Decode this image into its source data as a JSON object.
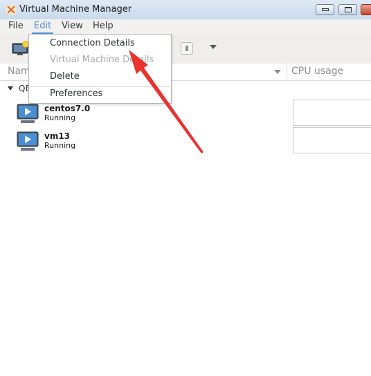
{
  "window": {
    "title": "Virtual Machine Manager",
    "icon": "virt-manager-icon"
  },
  "menubar": {
    "items": [
      {
        "label": "File"
      },
      {
        "label": "Edit",
        "active": true
      },
      {
        "label": "View"
      },
      {
        "label": "Help"
      }
    ]
  },
  "edit_menu": {
    "items": [
      {
        "label": "Connection Details",
        "enabled": true
      },
      {
        "label": "Virtual Machine Details",
        "enabled": false
      },
      {
        "label": "Delete",
        "enabled": true
      },
      {
        "label": "Preferences",
        "enabled": true
      }
    ]
  },
  "columns": {
    "name": "Nam",
    "cpu": "CPU usage"
  },
  "connection": {
    "label": "QE"
  },
  "vms": [
    {
      "name": "centos7.0",
      "status": "Running"
    },
    {
      "name": "vm13",
      "status": "Running"
    }
  ],
  "colors": {
    "accent": "#4a90d9",
    "annotation_arrow": "#e8332f"
  }
}
